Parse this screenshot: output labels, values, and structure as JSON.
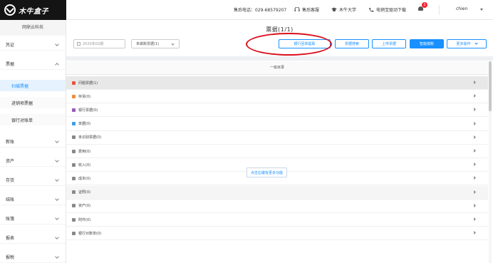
{
  "header": {
    "logo_text": "木牛盒子",
    "hotline": "售后电话：029-68579207",
    "support": "售后客服",
    "university": "木牛大学",
    "driver_download": "电销宝驱动下载",
    "notification_count": "1",
    "username": "chien"
  },
  "sidebar": {
    "company": "网鼎云科技",
    "items": [
      {
        "label": "凭证"
      },
      {
        "label": "票据"
      },
      {
        "label": "新账"
      },
      {
        "label": "资产"
      },
      {
        "label": "存货"
      },
      {
        "label": "结账"
      },
      {
        "label": "账簿"
      },
      {
        "label": "报表"
      },
      {
        "label": "报税"
      }
    ],
    "subitems": [
      {
        "label": "扫描票据"
      },
      {
        "label": "进销项票据"
      },
      {
        "label": "银行对账单"
      }
    ]
  },
  "main": {
    "title": "票据(1/1)",
    "period_placeholder": "2020年02期",
    "filter_select": "未做账票据(1)",
    "buttons": {
      "bank_receipt": "银行回单提取",
      "search": "票据搜索",
      "upload": "上传票据",
      "smart_account": "智能做账",
      "more": "更多操作"
    },
    "directory_title": "一级目录",
    "rows": [
      {
        "label": "问题票据(1)",
        "color": "#e8543f"
      },
      {
        "label": "存货(0)",
        "color": "#f08c3a"
      },
      {
        "label": "银行票据(0)",
        "color": "#9b59b6"
      },
      {
        "label": "单据(0)",
        "color": "#3a9ee8"
      },
      {
        "label": "未识别票据(0)",
        "color": "#888888"
      },
      {
        "label": "费用(0)",
        "color": "#888888"
      },
      {
        "label": "收入(0)",
        "color": "#888888"
      },
      {
        "label": "成本(0)",
        "color": "#888888"
      },
      {
        "label": "证照(0)",
        "color": "#888888"
      },
      {
        "label": "资产(0)",
        "color": "#888888"
      },
      {
        "label": "附件(0)",
        "color": "#888888"
      },
      {
        "label": "银行对账单(0)",
        "color": "#888888"
      }
    ],
    "context_tip": "点击右键有更多功能"
  }
}
